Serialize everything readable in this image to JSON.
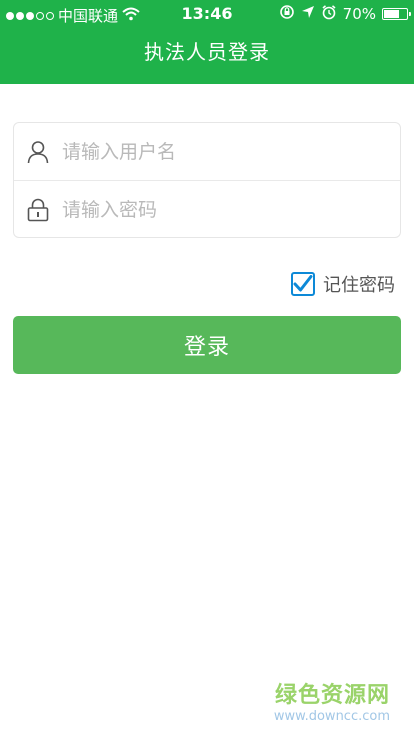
{
  "status_bar": {
    "carrier": "中国联通",
    "time": "13:46",
    "battery": "70%",
    "battery_level": 0.7,
    "icons": [
      "signal-dots-icon",
      "wifi-icon",
      "orientation-lock-icon",
      "location-arrow-icon",
      "alarm-icon",
      "battery-icon"
    ]
  },
  "nav": {
    "title": "执法人员登录"
  },
  "form": {
    "username_placeholder": "请输入用户名",
    "password_placeholder": "请输入密码",
    "icons": {
      "username": "user-icon",
      "password": "lock-icon"
    }
  },
  "remember": {
    "label": "记住密码",
    "checked": true
  },
  "login_button": {
    "label": "登录"
  },
  "watermark": {
    "title": "绿色资源网",
    "url": "www.downcc.com"
  },
  "colors": {
    "header_green": "#1fb24a",
    "button_green": "#57b85a",
    "checkbox_blue": "#0d89d7",
    "placeholder_gray": "#b9b9b9"
  }
}
